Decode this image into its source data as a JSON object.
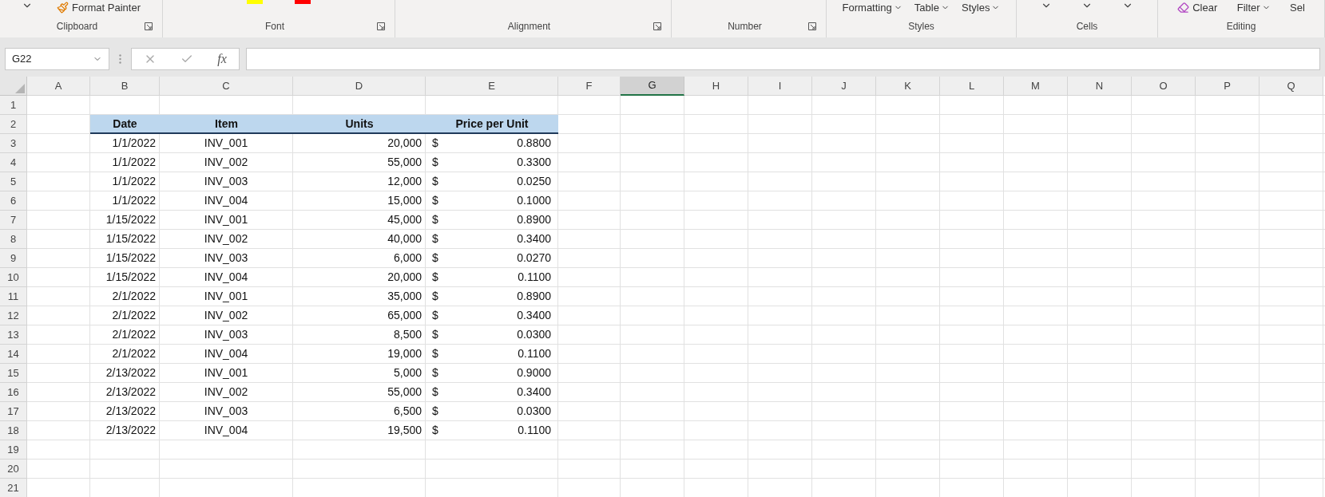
{
  "ribbon": {
    "groups": [
      {
        "label": "Clipboard",
        "launcher": true,
        "items": [
          {
            "kind": "chevron"
          },
          {
            "kind": "painter",
            "label": "Format Painter"
          }
        ]
      },
      {
        "label": "Font",
        "launcher": true,
        "items": [
          {
            "kind": "swatches"
          }
        ]
      },
      {
        "label": "Alignment",
        "launcher": true
      },
      {
        "label": "Number",
        "launcher": true
      },
      {
        "label": "Styles",
        "launcher": false,
        "items": [
          {
            "kind": "dropdown",
            "label": "Formatting"
          },
          {
            "kind": "dropdown",
            "label": "Table"
          },
          {
            "kind": "dropdown",
            "label": "Styles"
          }
        ]
      },
      {
        "label": "Cells",
        "launcher": false,
        "items": [
          {
            "kind": "chevron"
          },
          {
            "kind": "chevron"
          },
          {
            "kind": "chevron"
          }
        ]
      },
      {
        "label": "Editing",
        "launcher": false,
        "items": [
          {
            "kind": "clear",
            "label": "Clear"
          },
          {
            "kind": "dropdown",
            "label": "Filter"
          },
          {
            "kind": "text",
            "label": "Sel"
          }
        ]
      }
    ]
  },
  "formula_bar": {
    "name_box": "G22",
    "fx": "fx"
  },
  "columns": [
    {
      "label": "A",
      "selected": false
    },
    {
      "label": "B",
      "selected": false
    },
    {
      "label": "C",
      "selected": false
    },
    {
      "label": "D",
      "selected": false
    },
    {
      "label": "E",
      "selected": false
    },
    {
      "label": "F",
      "selected": false
    },
    {
      "label": "G",
      "selected": true
    },
    {
      "label": "H",
      "selected": false
    },
    {
      "label": "I",
      "selected": false
    },
    {
      "label": "J",
      "selected": false
    },
    {
      "label": "K",
      "selected": false
    },
    {
      "label": "L",
      "selected": false
    },
    {
      "label": "M",
      "selected": false
    },
    {
      "label": "N",
      "selected": false
    },
    {
      "label": "O",
      "selected": false
    },
    {
      "label": "P",
      "selected": false
    },
    {
      "label": "Q",
      "selected": false
    }
  ],
  "rows": [
    "1",
    "2",
    "3",
    "4",
    "5",
    "6",
    "7",
    "8",
    "9",
    "10",
    "11",
    "12",
    "13",
    "14",
    "15",
    "16",
    "17",
    "18",
    "19",
    "20",
    "21"
  ],
  "table": {
    "headers": [
      "Date",
      "Item",
      "Units",
      "Price per Unit"
    ],
    "rows": [
      {
        "date": "1/1/2022",
        "item": "INV_001",
        "units": "20,000",
        "price": {
          "currency": "$",
          "amount": "0.8800"
        }
      },
      {
        "date": "1/1/2022",
        "item": "INV_002",
        "units": "55,000",
        "price": {
          "currency": "$",
          "amount": "0.3300"
        }
      },
      {
        "date": "1/1/2022",
        "item": "INV_003",
        "units": "12,000",
        "price": {
          "currency": "$",
          "amount": "0.0250"
        }
      },
      {
        "date": "1/1/2022",
        "item": "INV_004",
        "units": "15,000",
        "price": {
          "currency": "$",
          "amount": "0.1000"
        }
      },
      {
        "date": "1/15/2022",
        "item": "INV_001",
        "units": "45,000",
        "price": {
          "currency": "$",
          "amount": "0.8900"
        }
      },
      {
        "date": "1/15/2022",
        "item": "INV_002",
        "units": "40,000",
        "price": {
          "currency": "$",
          "amount": "0.3400"
        }
      },
      {
        "date": "1/15/2022",
        "item": "INV_003",
        "units": "6,000",
        "price": {
          "currency": "$",
          "amount": "0.0270"
        }
      },
      {
        "date": "1/15/2022",
        "item": "INV_004",
        "units": "20,000",
        "price": {
          "currency": "$",
          "amount": "0.1100"
        }
      },
      {
        "date": "2/1/2022",
        "item": "INV_001",
        "units": "35,000",
        "price": {
          "currency": "$",
          "amount": "0.8900"
        }
      },
      {
        "date": "2/1/2022",
        "item": "INV_002",
        "units": "65,000",
        "price": {
          "currency": "$",
          "amount": "0.3400"
        }
      },
      {
        "date": "2/1/2022",
        "item": "INV_003",
        "units": "8,500",
        "price": {
          "currency": "$",
          "amount": "0.0300"
        }
      },
      {
        "date": "2/1/2022",
        "item": "INV_004",
        "units": "19,000",
        "price": {
          "currency": "$",
          "amount": "0.1100"
        }
      },
      {
        "date": "2/13/2022",
        "item": "INV_001",
        "units": "5,000",
        "price": {
          "currency": "$",
          "amount": "0.9000"
        }
      },
      {
        "date": "2/13/2022",
        "item": "INV_002",
        "units": "55,000",
        "price": {
          "currency": "$",
          "amount": "0.3400"
        }
      },
      {
        "date": "2/13/2022",
        "item": "INV_003",
        "units": "6,500",
        "price": {
          "currency": "$",
          "amount": "0.0300"
        }
      },
      {
        "date": "2/13/2022",
        "item": "INV_004",
        "units": "19,500",
        "price": {
          "currency": "$",
          "amount": "0.1100"
        }
      }
    ]
  }
}
